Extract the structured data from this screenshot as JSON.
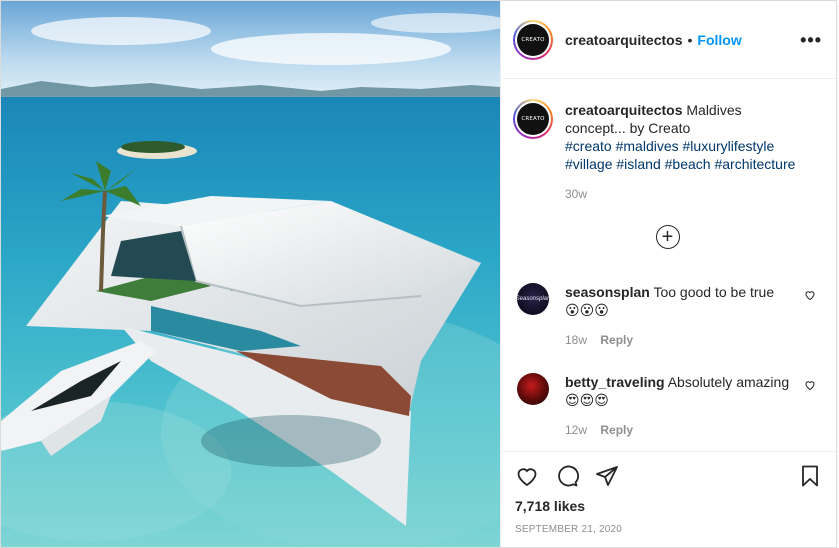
{
  "post": {
    "image_description_icon": "villa-photo",
    "author": {
      "username": "creatoarquitectos",
      "avatar_text": "CREATO",
      "follow_label": "Follow",
      "separator": "•",
      "more_label": "•••"
    },
    "caption": {
      "username": "creatoarquitectos",
      "text": "Maldives concept... by Creato",
      "hashtags": [
        "#creato",
        "#maldives",
        "#luxurylifestyle",
        "#village",
        "#island",
        "#beach",
        "#architecture"
      ],
      "time": "30w"
    },
    "load_more_label": "+",
    "comments": [
      {
        "username": "seasonsplan",
        "text": "Too good to be true",
        "emoji": "😮😮😮",
        "time": "18w",
        "reply_label": "Reply",
        "avatar_text": "Seasonsplan"
      },
      {
        "username": "betty_traveling",
        "text": "Absolutely amazing",
        "emoji": "😍😍😍",
        "time": "12w",
        "reply_label": "Reply"
      }
    ],
    "likes": "7,718 likes",
    "date": "September 21, 2020"
  },
  "colors": {
    "follow": "#0095f6",
    "hashtag": "#00376b",
    "muted": "#8e8e8e"
  }
}
